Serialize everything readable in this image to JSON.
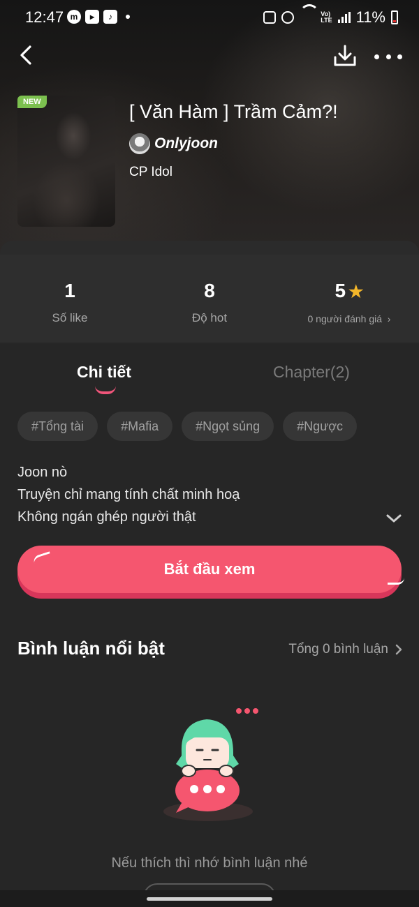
{
  "status_bar": {
    "time": "12:47",
    "battery": "11%"
  },
  "book": {
    "badge": "NEW",
    "title": "[ Văn Hàm ] Trầm Cảm?!",
    "author": "Onlyjoon",
    "category": "CP Idol"
  },
  "stats": [
    {
      "value": "1",
      "label": "Số like"
    },
    {
      "value": "8",
      "label": "Độ hot"
    },
    {
      "value": "5",
      "label": "0 người đánh giá"
    }
  ],
  "rating_stars": 1,
  "tabs": [
    {
      "label": "Chi tiết",
      "active": true
    },
    {
      "label": "Chapter(2)",
      "active": false
    }
  ],
  "tags": [
    "#Tổng tài",
    "#Mafia",
    "#Ngọt sủng",
    "#Ngược"
  ],
  "description": [
    "Joon nò",
    "Truyện chỉ mang tính chất minh hoạ",
    "Không ngán ghép người thật"
  ],
  "start_button": "Bắt đầu xem",
  "comments": {
    "title": "Bình luận nổi bật",
    "total": "Tổng 0 bình luận",
    "empty_message": "Nếu thích thì nhớ bình luận nhé"
  },
  "colors": {
    "accent": "#f5566f",
    "accent_dark": "#d8365a",
    "background": "#262626",
    "star": "#f4b72a",
    "new_badge": "#7cc04f"
  },
  "icons": {
    "back": "chevron-left-icon",
    "download": "download-icon",
    "more": "more-horizontal-icon",
    "expand": "chevron-down-icon",
    "star": "star-icon"
  }
}
